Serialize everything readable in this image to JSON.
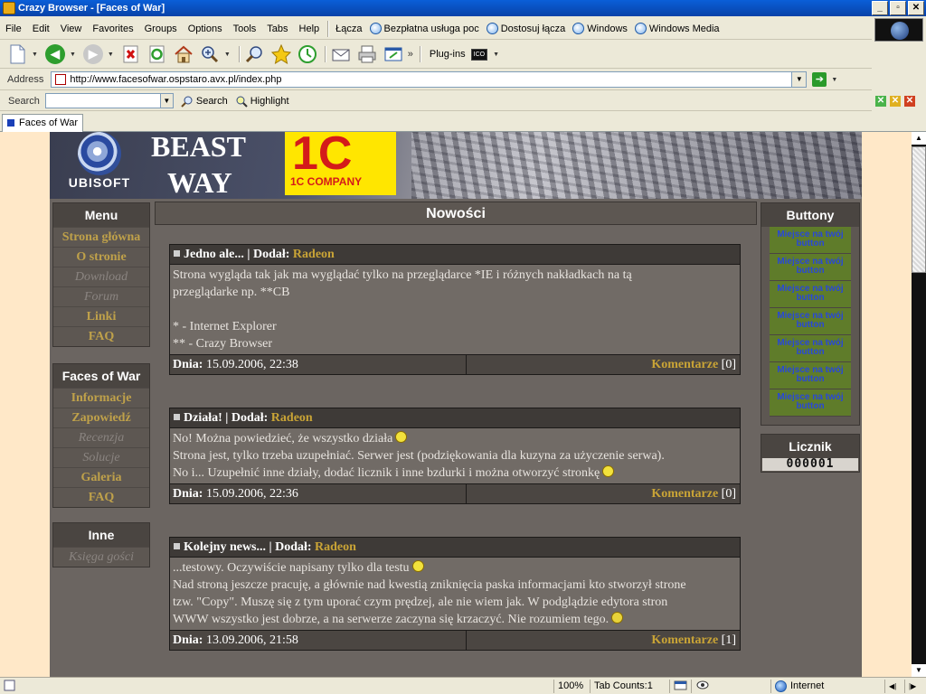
{
  "window": {
    "title": "Crazy Browser - [Faces of War]"
  },
  "menu": [
    "File",
    "Edit",
    "View",
    "Favorites",
    "Groups",
    "Options",
    "Tools",
    "Tabs",
    "Help"
  ],
  "links": {
    "label": "Łącza",
    "items": [
      "Bezpłatna usługa poc",
      "Dostosuj łącza",
      "Windows",
      "Windows Media"
    ]
  },
  "toolbar": {
    "plugins_label": "Plug-ins",
    "ico_label": "ICO",
    "more": "»"
  },
  "address": {
    "label": "Address",
    "url": "http://www.facesofwar.ospstaro.avx.pl/index.php"
  },
  "searchbar": {
    "label": "Search",
    "value": "",
    "search_btn": "Search",
    "highlight_btn": "Highlight"
  },
  "tabs": [
    {
      "label": "Faces of War"
    }
  ],
  "banner": {
    "ubisoft": "UBISOFT",
    "beast": "BEAST",
    "way": "WAY",
    "onec": "1C",
    "onec_company": "1C COMPANY"
  },
  "left": {
    "menu_title": "Menu",
    "menu_items": [
      {
        "label": "Strona główna",
        "dim": false
      },
      {
        "label": "O stronie",
        "dim": false
      },
      {
        "label": "Download",
        "dim": true
      },
      {
        "label": "Forum",
        "dim": true
      },
      {
        "label": "Linki",
        "dim": false
      },
      {
        "label": "FAQ",
        "dim": false
      }
    ],
    "fow_title": "Faces of War",
    "fow_items": [
      {
        "label": "Informacje",
        "dim": false
      },
      {
        "label": "Zapowiedź",
        "dim": false
      },
      {
        "label": "Recenzja",
        "dim": true
      },
      {
        "label": "Solucje",
        "dim": true
      },
      {
        "label": "Galeria",
        "dim": false
      },
      {
        "label": "FAQ",
        "dim": false
      }
    ],
    "other_title": "Inne",
    "other_items": [
      {
        "label": "Księga gości",
        "dim": true
      }
    ]
  },
  "main": {
    "title": "Nowości",
    "news": [
      {
        "title": "Jedno ale... | Dodał:",
        "author": "Radeon",
        "lines": [
          "Strona wygląda tak jak ma wyglądać tylko na przeglądarce *IE i różnych nakładkach na tą",
          "przeglądarke np. **CB",
          "",
          "* - Internet Explorer",
          "** - Crazy Browser"
        ],
        "date_label": "Dnia:",
        "date": "15.09.2006, 22:38",
        "comments_label": "Komentarze",
        "comments_count": "[0]"
      },
      {
        "title": "Działa! | Dodał:",
        "author": "Radeon",
        "lines": [
          "No! Można powiedzieć, że wszystko działa",
          "Strona jest, tylko trzeba uzupełniać. Serwer jest (podziękowania dla kuzyna za użyczenie serwa).",
          "No i... Uzupełnić inne działy, dodać licznik i inne bzdurki i można otworzyć stronkę"
        ],
        "date_label": "Dnia:",
        "date": "15.09.2006, 22:36",
        "comments_label": "Komentarze",
        "comments_count": "[0]"
      },
      {
        "title": "Kolejny news... | Dodał:",
        "author": "Radeon",
        "lines": [
          "...testowy. Oczywiście napisany tylko dla testu",
          "Nad stroną jeszcze pracuję, a głównie nad kwestią zniknięcia paska informacjami kto stworzył strone",
          "tzw. \"Copy\". Muszę się z tym uporać czym prędzej, ale nie wiem jak. W podglądzie edytora stron",
          "WWW wszystko jest dobrze, a na serwerze zaczyna się krzaczyć. Nie rozumiem tego."
        ],
        "date_label": "Dnia:",
        "date": "13.09.2006, 21:58",
        "comments_label": "Komentarze",
        "comments_count": "[1]"
      }
    ]
  },
  "right": {
    "buttons_title": "Buttony",
    "button_slot": "Miejsce na twój button",
    "counter_title": "Licznik",
    "counter_value": "000001"
  },
  "status": {
    "zoom": "100%",
    "tab_count": "Tab Counts:1",
    "zone": "Internet"
  },
  "colors": {
    "accent": "#c9a436",
    "site_bg": "#6b6561",
    "page_bg": "#ffe8c8"
  }
}
